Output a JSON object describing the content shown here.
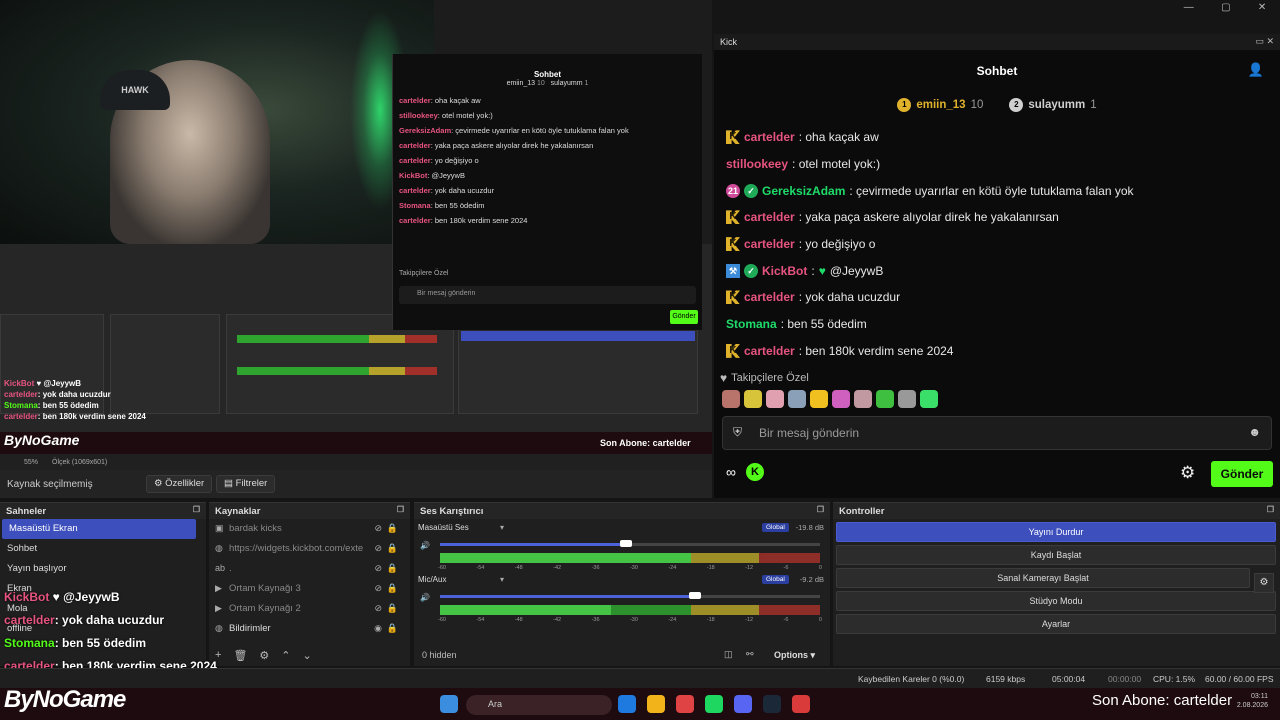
{
  "preview": {
    "cam_cap_text": "HAWK",
    "nested_chat": {
      "title": "Sohbet",
      "leaders": [
        "emiin_13",
        "10",
        "sulayumm",
        "1"
      ],
      "messages": [
        {
          "user": "cartelder",
          "text": "oha kaçak aw"
        },
        {
          "user": "stillookeey",
          "text": "otel motel yok:)"
        },
        {
          "user": "GereksizAdam",
          "text": "çevirmede uyarırlar en kötü öyle tutuklama falan yok"
        },
        {
          "user": "cartelder",
          "text": "yaka paça askere alıyolar direk he yakalanırsan"
        },
        {
          "user": "cartelder",
          "text": "yo değişiyo o"
        },
        {
          "user": "KickBot",
          "text": "@JeyywB"
        },
        {
          "user": "cartelder",
          "text": "yok daha ucuzdur"
        },
        {
          "user": "Stomana",
          "text": "ben 55 ödedim"
        },
        {
          "user": "cartelder",
          "text": "ben 180k verdim sene 2024"
        }
      ],
      "subonly": "Takipçilere Özel",
      "input_placeholder": "Bir mesaj gönderin",
      "send": "Gönder"
    },
    "overlay_lines": [
      {
        "user": "KickBot",
        "text": "@JeyywB"
      },
      {
        "user": "cartelder",
        "text": "yok daha ucuzdur"
      },
      {
        "user": "Stomana",
        "text": "ben 55 ödedim"
      },
      {
        "user": "cartelder",
        "text": "ben 180k verdim sene 2024"
      }
    ],
    "brand": "ByNoGame",
    "abone": "Son Abone: cartelder",
    "zoom": "55%",
    "canvas_label": "Ölçek (1069x601)"
  },
  "window": {
    "minimize": "—",
    "maximize": "▢",
    "close": "✕"
  },
  "chat": {
    "dock_title": "Kick",
    "title": "Sohbet",
    "leaders": [
      {
        "rank": "1",
        "name": "emiin_13",
        "count": "10",
        "color": "#e0b22c"
      },
      {
        "rank": "2",
        "name": "sulayumm",
        "count": "1",
        "color": "#cfcfcf"
      }
    ],
    "messages": [
      {
        "badges": [
          "k"
        ],
        "user": "cartelder",
        "color": "#e75480",
        "text": ": oha kaçak aw"
      },
      {
        "badges": [],
        "user": "stillookeey",
        "color": "#e75480",
        "text": ": otel motel yok:)"
      },
      {
        "badges": [
          "21",
          "v"
        ],
        "user": "GereksizAdam",
        "color": "#1fdc6a",
        "text": ": çevirmede uyarırlar en kötü öyle tutuklama falan yok"
      },
      {
        "badges": [
          "k"
        ],
        "user": "cartelder",
        "color": "#e75480",
        "text": ": yaka paça askere alıyolar direk he yakalanırsan"
      },
      {
        "badges": [
          "k"
        ],
        "user": "cartelder",
        "color": "#e75480",
        "text": ": yo değişiyo o"
      },
      {
        "badges": [
          "b",
          "v"
        ],
        "user": "KickBot",
        "color": "#e75480",
        "text": ":",
        "heart": "♥",
        "extra": "@JeyywB"
      },
      {
        "badges": [
          "k"
        ],
        "user": "cartelder",
        "color": "#e75480",
        "text": ": yok daha ucuzdur"
      },
      {
        "badges": [],
        "user": "Stomana",
        "color": "#1fdc6a",
        "text": ": ben 55 ödedim"
      },
      {
        "badges": [
          "k"
        ],
        "user": "cartelder",
        "color": "#e75480",
        "text": ": ben 180k verdim sene 2024"
      }
    ],
    "subonly": "Takipçilere Özel",
    "input_placeholder": "Bir mesaj gönderin",
    "send_label": "Gönder"
  },
  "source_bar": {
    "label": "Kaynak seçilmemiş",
    "properties": "Özellikler",
    "filters": "Filtreler"
  },
  "scenes": {
    "title": "Sahneler",
    "items": [
      "Masaüstü Ekran",
      "Sohbet",
      "Yayın başlıyor",
      "Ekran",
      "Mola",
      "offline"
    ]
  },
  "sources": {
    "title": "Kaynaklar",
    "items": [
      {
        "icon": "▣",
        "name": "bardak kicks"
      },
      {
        "icon": "◍",
        "name": "https://widgets.kickbot.com/exte"
      },
      {
        "icon": "ab",
        "name": "."
      },
      {
        "icon": "▶",
        "name": "Ortam Kaynağı 3"
      },
      {
        "icon": "▶",
        "name": "Ortam Kaynağı 2"
      },
      {
        "icon": "◍",
        "name": "Bildirimler"
      }
    ]
  },
  "mixer": {
    "title": "Ses Karıştırıcı",
    "channels": [
      {
        "name": "Masaüstü Ses",
        "global": "Global",
        "db": "-19.8 dB",
        "volume": 0.49,
        "level": 0.66
      },
      {
        "name": "Mic/Aux",
        "global": "Global",
        "db": "-9.2 dB",
        "volume": 0.67,
        "level": 0.45
      }
    ],
    "ticks": [
      "-60",
      "-54",
      "-48",
      "-42",
      "-36",
      "-30",
      "-24",
      "-18",
      "-12",
      "-6",
      "0"
    ],
    "hidden": "0 hidden",
    "options": "Options"
  },
  "controls": {
    "title": "Kontroller",
    "buttons": [
      "Yayını Durdur",
      "Kaydı Başlat",
      "Sanal Kamerayı Başlat",
      "Stüdyo Modu",
      "Ayarlar"
    ]
  },
  "status": {
    "dropped": "Kaybedilen Kareler 0 (%0.0)",
    "bitrate": "6159 kbps",
    "stream_time": "05:00:04",
    "rec_time": "00:00:00",
    "cpu": "CPU: 1.5%",
    "fps": "60.00 / 60.00 FPS"
  },
  "taskbar": {
    "brand": "ByNoGame",
    "search": "Ara",
    "abone": "Son Abone: cartelder",
    "time": "03:11",
    "date": "2.08.2026"
  }
}
